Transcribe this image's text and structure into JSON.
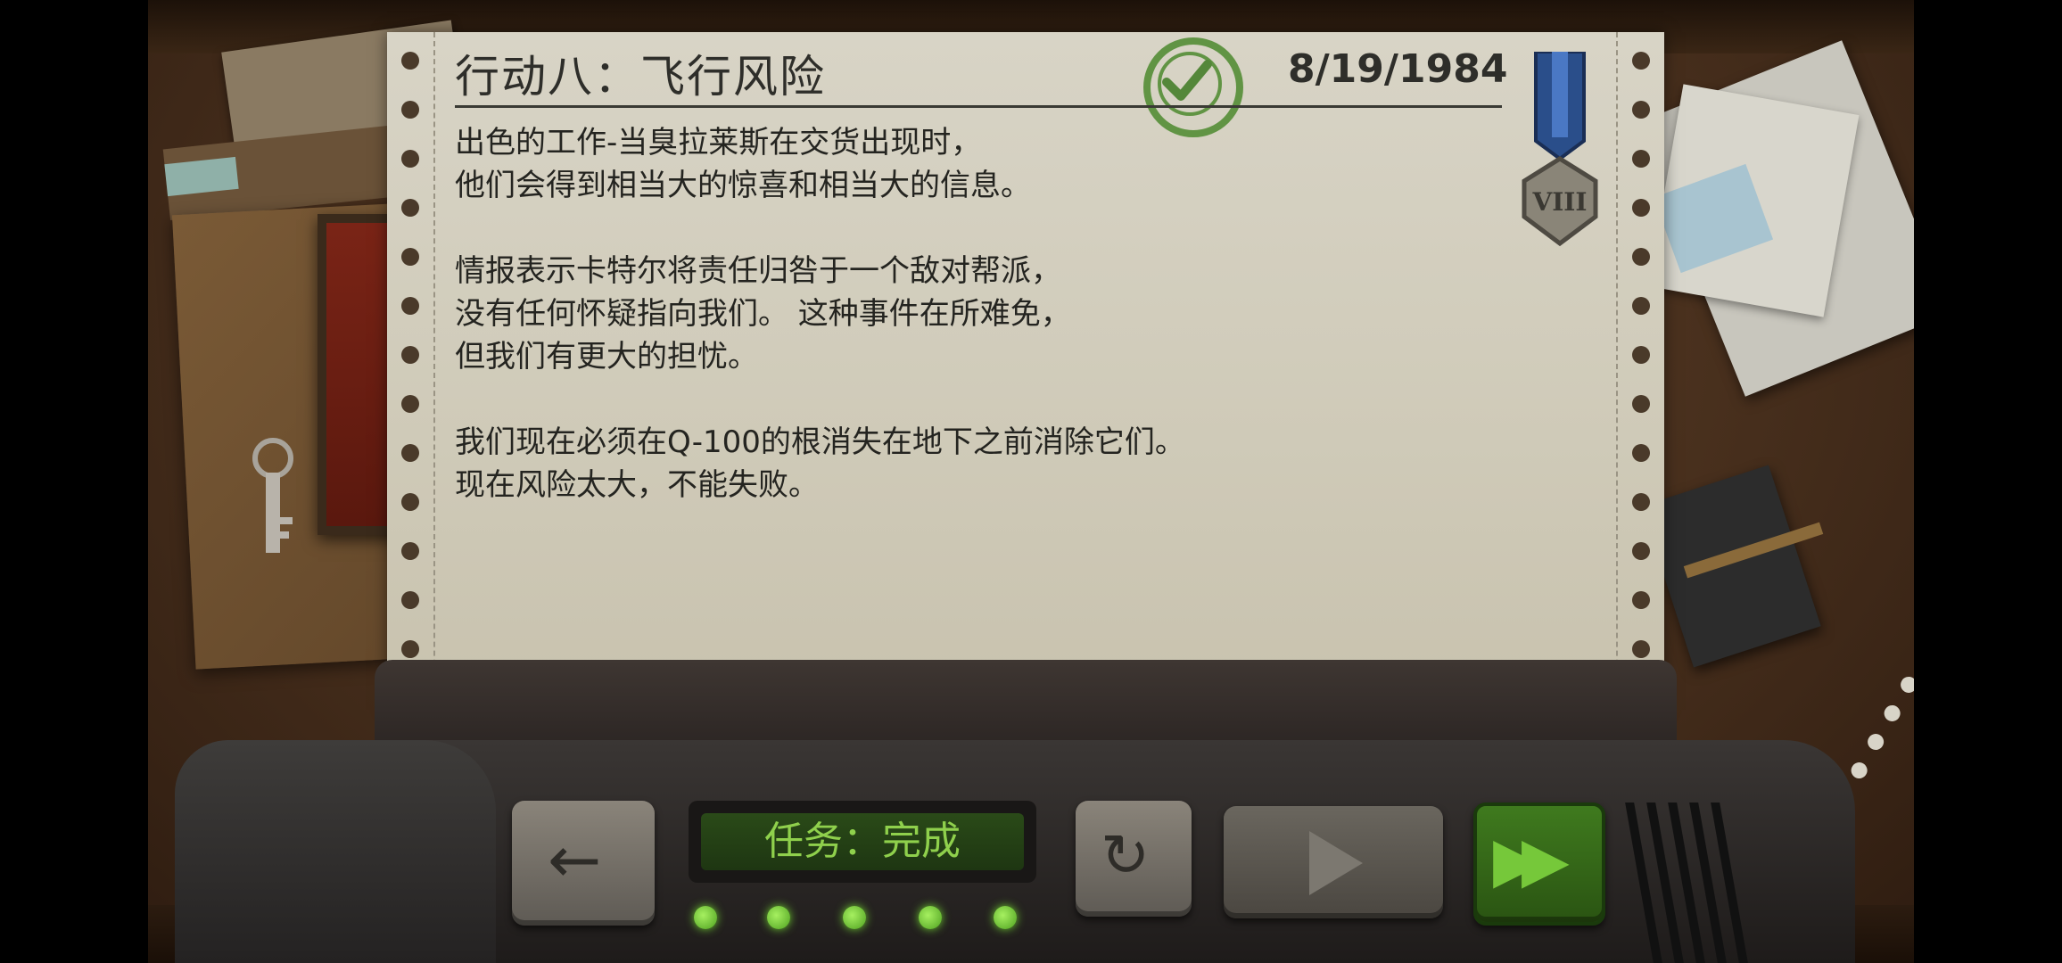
{
  "mission": {
    "title": "行动八：飞行风险",
    "date": "8/19/1984",
    "medal_numeral": "VIII",
    "body_paragraphs": [
      [
        "出色的工作-当臭拉莱斯在交货出现时，",
        "他们会得到相当大的惊喜和相当大的信息。"
      ],
      [
        "情报表示卡特尔将责任归咎于一个敌对帮派，",
        "没有任何怀疑指向我们。 这种事件在所难免，",
        "但我们有更大的担忧。"
      ],
      [
        "我们现在必须在Q-100的根消失在地下之前消除它们。",
        "现在风险太大，不能失败。"
      ]
    ]
  },
  "console": {
    "status_text": "任务：完成",
    "progress_leds": 5
  },
  "colors": {
    "paper": "#d4d0c2",
    "text": "#242420",
    "stamp_green": "#4d8a2e",
    "lcd_green": "#8fd04c",
    "accent_button": "#3f7a1e"
  },
  "icons": [
    "back-arrow-icon",
    "replay-icon",
    "play-icon",
    "fast-forward-icon",
    "checkmark-stamp-icon",
    "medal-icon"
  ]
}
